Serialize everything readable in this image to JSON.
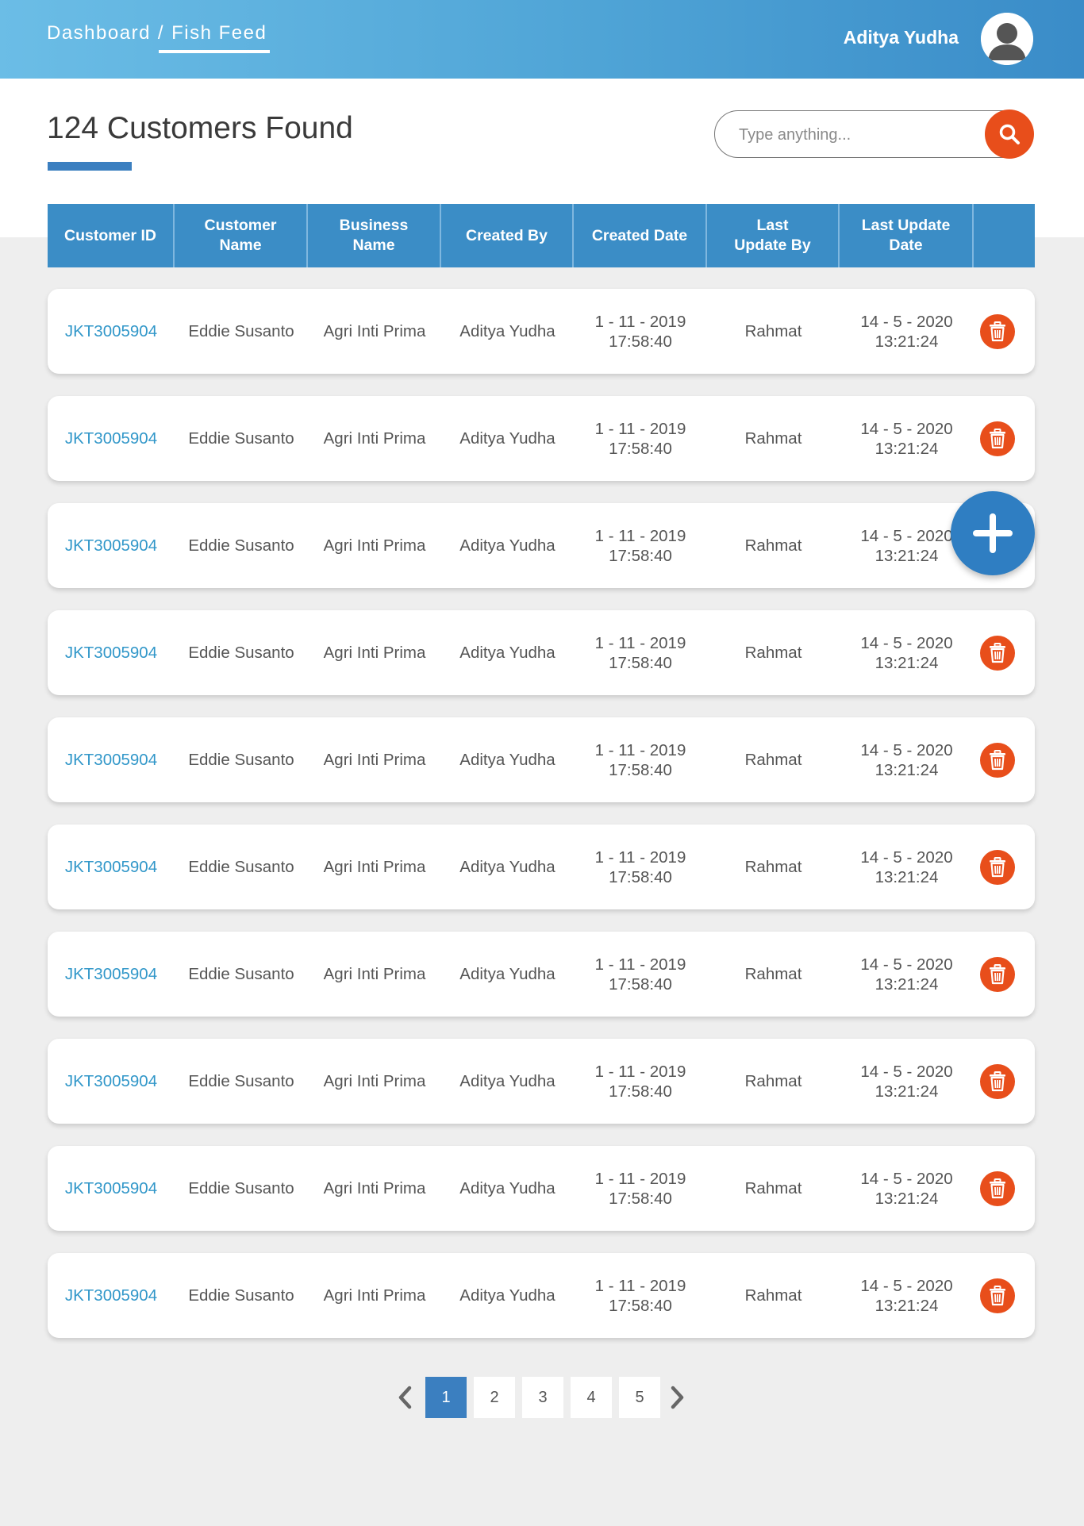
{
  "header": {
    "breadcrumb": [
      "Dashboard",
      "Fish Feed"
    ],
    "separator": "/",
    "user_name": "Aditya Yudha"
  },
  "page": {
    "title": "124 Customers Found"
  },
  "search": {
    "placeholder": "Type anything..."
  },
  "table": {
    "columns": [
      "Customer ID",
      "Customer Name",
      "Business Name",
      "Created By",
      "Created Date",
      "Last Update By",
      "Last Update Date"
    ],
    "rows": [
      {
        "id": "JKT3005904",
        "name": "Eddie Susanto",
        "business": "Agri Inti Prima",
        "created_by": "Aditya Yudha",
        "created_date": "1 - 11 - 2019",
        "created_time": "17:58:40",
        "updated_by": "Rahmat",
        "updated_date": "14 - 5 - 2020",
        "updated_time": "13:21:24"
      },
      {
        "id": "JKT3005904",
        "name": "Eddie Susanto",
        "business": "Agri Inti Prima",
        "created_by": "Aditya Yudha",
        "created_date": "1 - 11 - 2019",
        "created_time": "17:58:40",
        "updated_by": "Rahmat",
        "updated_date": "14 - 5 - 2020",
        "updated_time": "13:21:24"
      },
      {
        "id": "JKT3005904",
        "name": "Eddie Susanto",
        "business": "Agri Inti Prima",
        "created_by": "Aditya Yudha",
        "created_date": "1 - 11 - 2019",
        "created_time": "17:58:40",
        "updated_by": "Rahmat",
        "updated_date": "14 - 5 - 2020",
        "updated_time": "13:21:24"
      },
      {
        "id": "JKT3005904",
        "name": "Eddie Susanto",
        "business": "Agri Inti Prima",
        "created_by": "Aditya Yudha",
        "created_date": "1 - 11 - 2019",
        "created_time": "17:58:40",
        "updated_by": "Rahmat",
        "updated_date": "14 - 5 - 2020",
        "updated_time": "13:21:24"
      },
      {
        "id": "JKT3005904",
        "name": "Eddie Susanto",
        "business": "Agri Inti Prima",
        "created_by": "Aditya Yudha",
        "created_date": "1 - 11 - 2019",
        "created_time": "17:58:40",
        "updated_by": "Rahmat",
        "updated_date": "14 - 5 - 2020",
        "updated_time": "13:21:24"
      },
      {
        "id": "JKT3005904",
        "name": "Eddie Susanto",
        "business": "Agri Inti Prima",
        "created_by": "Aditya Yudha",
        "created_date": "1 - 11 - 2019",
        "created_time": "17:58:40",
        "updated_by": "Rahmat",
        "updated_date": "14 - 5 - 2020",
        "updated_time": "13:21:24"
      },
      {
        "id": "JKT3005904",
        "name": "Eddie Susanto",
        "business": "Agri Inti Prima",
        "created_by": "Aditya Yudha",
        "created_date": "1 - 11 - 2019",
        "created_time": "17:58:40",
        "updated_by": "Rahmat",
        "updated_date": "14 - 5 - 2020",
        "updated_time": "13:21:24"
      },
      {
        "id": "JKT3005904",
        "name": "Eddie Susanto",
        "business": "Agri Inti Prima",
        "created_by": "Aditya Yudha",
        "created_date": "1 - 11 - 2019",
        "created_time": "17:58:40",
        "updated_by": "Rahmat",
        "updated_date": "14 - 5 - 2020",
        "updated_time": "13:21:24"
      },
      {
        "id": "JKT3005904",
        "name": "Eddie Susanto",
        "business": "Agri Inti Prima",
        "created_by": "Aditya Yudha",
        "created_date": "1 - 11 - 2019",
        "created_time": "17:58:40",
        "updated_by": "Rahmat",
        "updated_date": "14 - 5 - 2020",
        "updated_time": "13:21:24"
      },
      {
        "id": "JKT3005904",
        "name": "Eddie Susanto",
        "business": "Agri Inti Prima",
        "created_by": "Aditya Yudha",
        "created_date": "1 - 11 - 2019",
        "created_time": "17:58:40",
        "updated_by": "Rahmat",
        "updated_date": "14 - 5 - 2020",
        "updated_time": "13:21:24"
      }
    ]
  },
  "pagination": {
    "pages": [
      "1",
      "2",
      "3",
      "4",
      "5"
    ],
    "current": "1"
  },
  "icons": {
    "search": "search-icon",
    "delete": "trash-icon",
    "add": "plus-icon",
    "avatar": "user-avatar-icon",
    "prev": "chevron-left-icon",
    "next": "chevron-right-icon"
  },
  "colors": {
    "header_gradient_start": "#6bbde6",
    "header_gradient_end": "#3a8cc8",
    "table_header": "#3b8dc6",
    "accent_blue": "#3b7fc0",
    "danger": "#e84e1b",
    "link": "#3197c9"
  }
}
